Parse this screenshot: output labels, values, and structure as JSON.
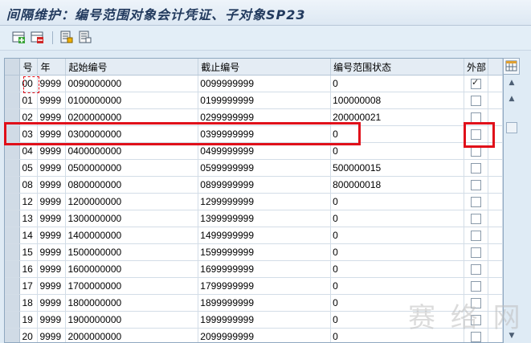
{
  "title": "间隔维护：编号范围对象会计凭证、子对象SP23",
  "toolbar": {
    "buttons": [
      "add-interval-icon",
      "delete-interval-icon",
      "select-all-icon",
      "deselect-all-icon"
    ]
  },
  "table": {
    "headers": {
      "sel": "",
      "no": "号",
      "year": "年",
      "from": "起始编号",
      "to": "截止编号",
      "status": "编号范围状态",
      "external": "外部"
    },
    "rows": [
      {
        "no": "00",
        "year": "9999",
        "from": "0090000000",
        "to": "0099999999",
        "status": "0",
        "external": true
      },
      {
        "no": "01",
        "year": "9999",
        "from": "0100000000",
        "to": "0199999999",
        "status": "100000008",
        "external": false
      },
      {
        "no": "02",
        "year": "9999",
        "from": "0200000000",
        "to": "0299999999",
        "status": "200000021",
        "external": false
      },
      {
        "no": "03",
        "year": "9999",
        "from": "0300000000",
        "to": "0399999999",
        "status": "0",
        "external": false
      },
      {
        "no": "04",
        "year": "9999",
        "from": "0400000000",
        "to": "0499999999",
        "status": "0",
        "external": false
      },
      {
        "no": "05",
        "year": "9999",
        "from": "0500000000",
        "to": "0599999999",
        "status": "500000015",
        "external": false
      },
      {
        "no": "08",
        "year": "9999",
        "from": "0800000000",
        "to": "0899999999",
        "status": "800000018",
        "external": false
      },
      {
        "no": "12",
        "year": "9999",
        "from": "1200000000",
        "to": "1299999999",
        "status": "0",
        "external": false
      },
      {
        "no": "13",
        "year": "9999",
        "from": "1300000000",
        "to": "1399999999",
        "status": "0",
        "external": false
      },
      {
        "no": "14",
        "year": "9999",
        "from": "1400000000",
        "to": "1499999999",
        "status": "0",
        "external": false
      },
      {
        "no": "15",
        "year": "9999",
        "from": "1500000000",
        "to": "1599999999",
        "status": "0",
        "external": false
      },
      {
        "no": "16",
        "year": "9999",
        "from": "1600000000",
        "to": "1699999999",
        "status": "0",
        "external": false
      },
      {
        "no": "17",
        "year": "9999",
        "from": "1700000000",
        "to": "1799999999",
        "status": "0",
        "external": false
      },
      {
        "no": "18",
        "year": "9999",
        "from": "1800000000",
        "to": "1899999999",
        "status": "0",
        "external": false
      },
      {
        "no": "19",
        "year": "9999",
        "from": "1900000000",
        "to": "1999999999",
        "status": "0",
        "external": false
      },
      {
        "no": "20",
        "year": "9999",
        "from": "2000000000",
        "to": "2099999999",
        "status": "0",
        "external": false
      }
    ]
  },
  "watermark": "赛 络 网",
  "colors": {
    "highlight": "#e0101a",
    "header_bg": "#e4ecf4",
    "window_bg": "#dfebf5"
  }
}
